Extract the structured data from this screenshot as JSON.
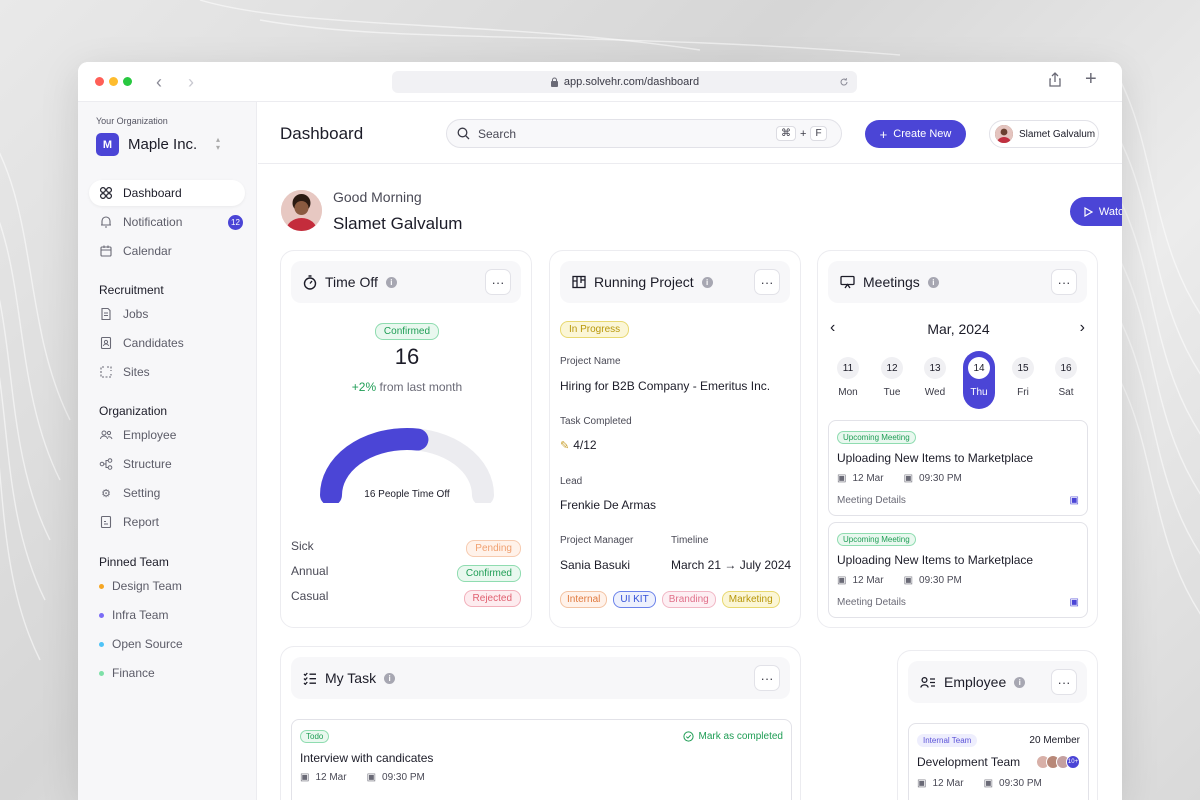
{
  "browser": {
    "url": "app.solvehr.com/dashboard"
  },
  "sidebar": {
    "org_label": "Your Organization",
    "org_initial": "M",
    "org_name": "Maple Inc.",
    "main_items": [
      {
        "label": "Dashboard",
        "icon": "grid-icon"
      },
      {
        "label": "Notification",
        "icon": "bell-icon",
        "badge": "12"
      },
      {
        "label": "Calendar",
        "icon": "calendar-icon"
      }
    ],
    "recruitment": {
      "title": "Recruitment",
      "items": [
        {
          "label": "Jobs",
          "icon": "document-icon"
        },
        {
          "label": "Candidates",
          "icon": "id-card-icon"
        },
        {
          "label": "Sites",
          "icon": "sites-icon"
        }
      ]
    },
    "organization": {
      "title": "Organization",
      "items": [
        {
          "label": "Employee",
          "icon": "people-icon"
        },
        {
          "label": "Structure",
          "icon": "structure-icon"
        },
        {
          "label": "Setting",
          "icon": "gear-icon"
        },
        {
          "label": "Report",
          "icon": "report-icon"
        }
      ]
    },
    "pinned": {
      "title": "Pinned Team",
      "items": [
        {
          "label": "Design Team",
          "color": "#f5a623"
        },
        {
          "label": "Infra Team",
          "color": "#7b6cf6"
        },
        {
          "label": "Open Source",
          "color": "#4fc3f7"
        },
        {
          "label": "Finance",
          "color": "#7ee0a8"
        }
      ]
    }
  },
  "header": {
    "title": "Dashboard",
    "search_placeholder": "Search",
    "shortcut": {
      "cmd": "⌘",
      "plus": "+",
      "key": "F"
    },
    "create_label": "Create New",
    "user_name": "Slamet Galvalum"
  },
  "greeting": {
    "salutation": "Good Morning",
    "name": "Slamet Galvalum",
    "watch_demo": "Watch Demo"
  },
  "time_off": {
    "title": "Time Off",
    "status": "Confirmed",
    "count": "16",
    "change": "+2%",
    "change_suffix": "from last month",
    "gauge_label": "16 People Time Off",
    "gauge_fraction": 0.55,
    "rows": [
      {
        "label": "Sick",
        "status": "Pending",
        "tone": "orange"
      },
      {
        "label": "Annual",
        "status": "Confirmed",
        "tone": "green"
      },
      {
        "label": "Casual",
        "status": "Rejected",
        "tone": "red"
      }
    ]
  },
  "project": {
    "title": "Running Project",
    "status": "In Progress",
    "name_label": "Project Name",
    "name": "Hiring for B2B Company - Emeritus Inc.",
    "task_label": "Task Completed",
    "task_value": "4/12",
    "lead_label": "Lead",
    "lead": "Frenkie De Armas",
    "pm_label": "Project Manager",
    "pm": "Sania Basuki",
    "timeline_label": "Timeline",
    "timeline": "March 21 → July 2024",
    "tags": [
      {
        "label": "Internal",
        "tone": "orange2"
      },
      {
        "label": "UI KIT",
        "tone": "blue"
      },
      {
        "label": "Branding",
        "tone": "pink"
      },
      {
        "label": "Marketing",
        "tone": "yellow"
      }
    ]
  },
  "meetings": {
    "title": "Meetings",
    "month": "Mar, 2024",
    "days": [
      {
        "num": "11",
        "name": "Mon"
      },
      {
        "num": "12",
        "name": "Tue"
      },
      {
        "num": "13",
        "name": "Wed"
      },
      {
        "num": "14",
        "name": "Thu",
        "active": true
      },
      {
        "num": "15",
        "name": "Fri"
      },
      {
        "num": "16",
        "name": "Sat"
      }
    ],
    "items": [
      {
        "badge": "Upcoming Meeting",
        "title": "Uploading New Items to Marketplace",
        "date": "12 Mar",
        "time": "09:30 PM",
        "details": "Meeting Details"
      },
      {
        "badge": "Upcoming Meeting",
        "title": "Uploading New Items to Marketplace",
        "date": "12 Mar",
        "time": "09:30 PM",
        "details": "Meeting Details"
      }
    ]
  },
  "my_task": {
    "title": "My Task",
    "item": {
      "badge": "Todo",
      "title": "Interview with candicates",
      "date": "12 Mar",
      "time": "09:30 PM",
      "action": "Mark as completed"
    }
  },
  "employee": {
    "title": "Employee",
    "team": {
      "badge": "Internal Team",
      "members": "20 Member",
      "name": "Development Team",
      "date": "12 Mar",
      "time": "09:30 PM",
      "more": "10+"
    }
  },
  "colors": {
    "accent": "#4b45d6",
    "sidebar_bg": "#f7f7f9"
  }
}
